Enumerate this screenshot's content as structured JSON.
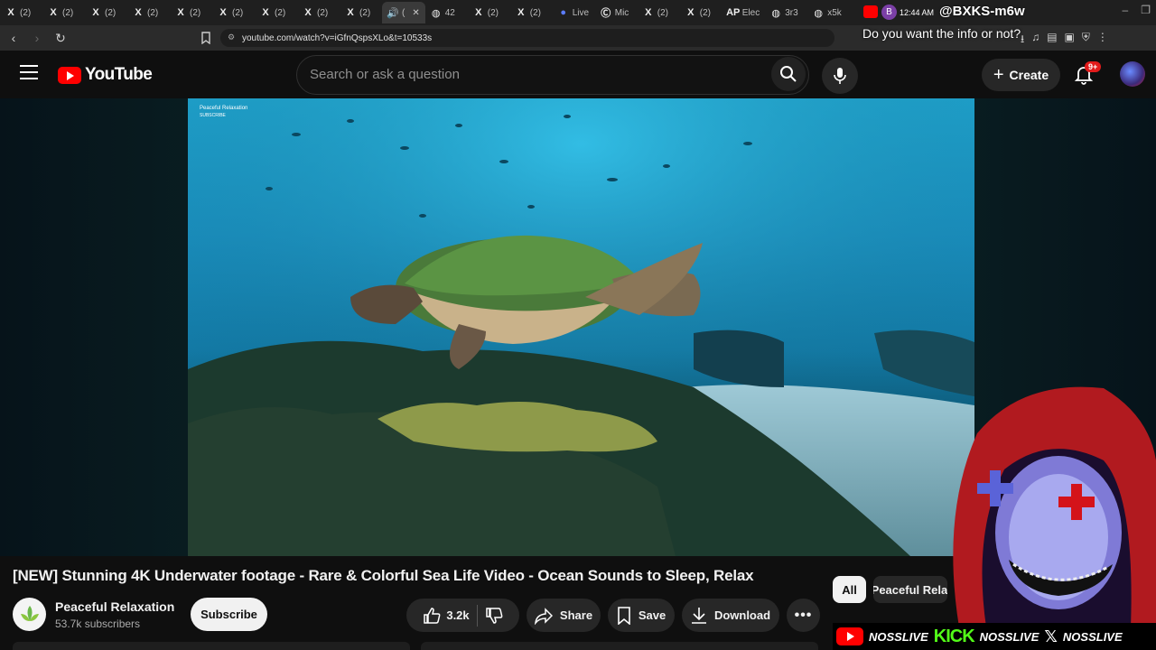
{
  "browser": {
    "tabs": [
      {
        "icon": "x-logo-icon",
        "label": "(2)"
      },
      {
        "icon": "x-logo-icon",
        "label": "(2)"
      },
      {
        "icon": "x-logo-icon",
        "label": "(2)"
      },
      {
        "icon": "x-logo-icon",
        "label": "(2)"
      },
      {
        "icon": "x-logo-icon",
        "label": "(2)"
      },
      {
        "icon": "x-logo-icon",
        "label": "(2)"
      },
      {
        "icon": "x-logo-icon",
        "label": "(2)"
      },
      {
        "icon": "x-logo-icon",
        "label": "(2)"
      },
      {
        "icon": "x-logo-icon",
        "label": "(2)"
      },
      {
        "icon": "speaker-icon",
        "label": "(",
        "active": true
      },
      {
        "icon": "globe-icon",
        "label": "42"
      },
      {
        "icon": "x-logo-icon",
        "label": "(2)"
      },
      {
        "icon": "x-logo-icon",
        "label": "(2)"
      },
      {
        "icon": "live-icon",
        "label": "Live"
      },
      {
        "icon": "mic-site-icon",
        "label": "Mic"
      },
      {
        "icon": "x-logo-icon",
        "label": "(2)"
      },
      {
        "icon": "x-logo-icon",
        "label": "(2)"
      },
      {
        "icon": "ap-icon",
        "label": "Elec"
      },
      {
        "icon": "globe-icon",
        "label": "3r3"
      },
      {
        "icon": "globe-icon",
        "label": "x5k"
      }
    ],
    "url": "youtube.com/watch?v=iGfnQspsXLo&t=10533s"
  },
  "stream_overlay": {
    "time": "12:44 AM",
    "handle": "@BXKS-m6w",
    "avatar_letter": "B",
    "question": "Do you want the info or not?",
    "social": [
      {
        "icon": "youtube-icon",
        "label": "NOSSLIVE"
      },
      {
        "icon": "kick-icon",
        "brand": "KICK",
        "label": "NOSSLIVE"
      },
      {
        "icon": "x-logo-icon",
        "label": "NOSSLIVE"
      }
    ]
  },
  "youtube": {
    "logo_text": "YouTube",
    "search_placeholder": "Search or ask a question",
    "create_label": "Create",
    "notifications_badge": "9+",
    "video": {
      "watermark_line1": "Peaceful Relaxation",
      "watermark_line2": "SUBSCRIBE",
      "title": "[NEW] Stunning 4K Underwater footage - Rare & Colorful Sea Life Video - Ocean Sounds to Sleep, Relax"
    },
    "channel": {
      "name": "Peaceful Relaxation",
      "subscribers": "53.7k subscribers",
      "subscribe_label": "Subscribe"
    },
    "actions": {
      "likes": "3.2k",
      "share": "Share",
      "save": "Save",
      "download": "Download"
    },
    "chips": {
      "all": "All",
      "from": "From Peaceful Relaxation"
    }
  }
}
